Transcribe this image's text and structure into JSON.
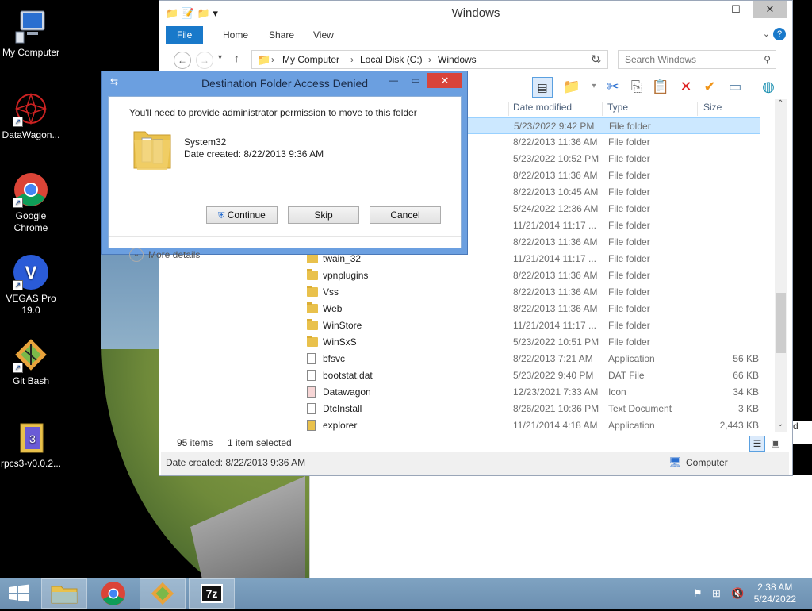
{
  "desktop": {
    "icons": [
      {
        "label": "My Computer"
      },
      {
        "label": "DataWagon..."
      },
      {
        "label": "Google Chrome"
      },
      {
        "label": "VEGAS Pro 19.0"
      },
      {
        "label": "Git Bash"
      },
      {
        "label": "rpcs3-v0.0.2..."
      }
    ],
    "partial_text": "d"
  },
  "explorer": {
    "title": "Windows",
    "tabs": {
      "file": "File",
      "home": "Home",
      "share": "Share",
      "view": "View"
    },
    "breadcrumb": [
      "My Computer",
      "Local Disk (C:)",
      "Windows"
    ],
    "search_placeholder": "Search Windows",
    "columns": {
      "date": "Date modified",
      "type": "Type",
      "size": "Size"
    },
    "rows": [
      {
        "name": "",
        "date": "5/23/2022 9:42 PM",
        "type": "File folder",
        "size": "",
        "kind": "folder",
        "selected": true
      },
      {
        "name": "",
        "date": "8/22/2013 11:36 AM",
        "type": "File folder",
        "size": "",
        "kind": "folder"
      },
      {
        "name": "",
        "date": "5/23/2022 10:52 PM",
        "type": "File folder",
        "size": "",
        "kind": "folder"
      },
      {
        "name": "",
        "date": "8/22/2013 11:36 AM",
        "type": "File folder",
        "size": "",
        "kind": "folder"
      },
      {
        "name": "",
        "date": "8/22/2013 10:45 AM",
        "type": "File folder",
        "size": "",
        "kind": "folder"
      },
      {
        "name": "",
        "date": "5/24/2022 12:36 AM",
        "type": "File folder",
        "size": "",
        "kind": "folder"
      },
      {
        "name": "",
        "date": "11/21/2014 11:17 ...",
        "type": "File folder",
        "size": "",
        "kind": "folder"
      },
      {
        "name": "",
        "date": "8/22/2013 11:36 AM",
        "type": "File folder",
        "size": "",
        "kind": "folder"
      },
      {
        "name": "twain_32",
        "date": "11/21/2014 11:17 ...",
        "type": "File folder",
        "size": "",
        "kind": "folder"
      },
      {
        "name": "vpnplugins",
        "date": "8/22/2013 11:36 AM",
        "type": "File folder",
        "size": "",
        "kind": "folder"
      },
      {
        "name": "Vss",
        "date": "8/22/2013 11:36 AM",
        "type": "File folder",
        "size": "",
        "kind": "folder"
      },
      {
        "name": "Web",
        "date": "8/22/2013 11:36 AM",
        "type": "File folder",
        "size": "",
        "kind": "folder"
      },
      {
        "name": "WinStore",
        "date": "11/21/2014 11:17 ...",
        "type": "File folder",
        "size": "",
        "kind": "folder"
      },
      {
        "name": "WinSxS",
        "date": "5/23/2022 10:51 PM",
        "type": "File folder",
        "size": "",
        "kind": "folder"
      },
      {
        "name": "bfsvc",
        "date": "8/22/2013 7:21 AM",
        "type": "Application",
        "size": "56 KB",
        "kind": "app"
      },
      {
        "name": "bootstat.dat",
        "date": "5/23/2022 9:40 PM",
        "type": "DAT File",
        "size": "66 KB",
        "kind": "file"
      },
      {
        "name": "Datawagon",
        "date": "12/23/2021 7:33 AM",
        "type": "Icon",
        "size": "34 KB",
        "kind": "icon"
      },
      {
        "name": "DtcInstall",
        "date": "8/26/2021 10:36 PM",
        "type": "Text Document",
        "size": "3 KB",
        "kind": "file"
      },
      {
        "name": "explorer",
        "date": "11/21/2014 4:18 AM",
        "type": "Application",
        "size": "2,443 KB",
        "kind": "explorer"
      }
    ],
    "status_items": "95 items",
    "status_selected": "1 item selected",
    "info_left": "Date created: 8/22/2013 9:36 AM",
    "info_right": "Computer"
  },
  "dialog": {
    "title": "Destination Folder Access Denied",
    "message": "You'll need to provide administrator permission to move to this folder",
    "folder_name": "System32",
    "folder_date": "Date created: 8/22/2013 9:36 AM",
    "buttons": {
      "continue": "Continue",
      "skip": "Skip",
      "cancel": "Cancel"
    },
    "more_details": "More details"
  },
  "taskbar": {
    "time": "2:38 AM",
    "date": "5/24/2022",
    "sevenzip_label": "7z"
  },
  "colors": {
    "accent": "#1979ca",
    "selection": "#cce8ff",
    "dialog_frame": "#6b9fe0",
    "close_red": "#d9443a"
  }
}
